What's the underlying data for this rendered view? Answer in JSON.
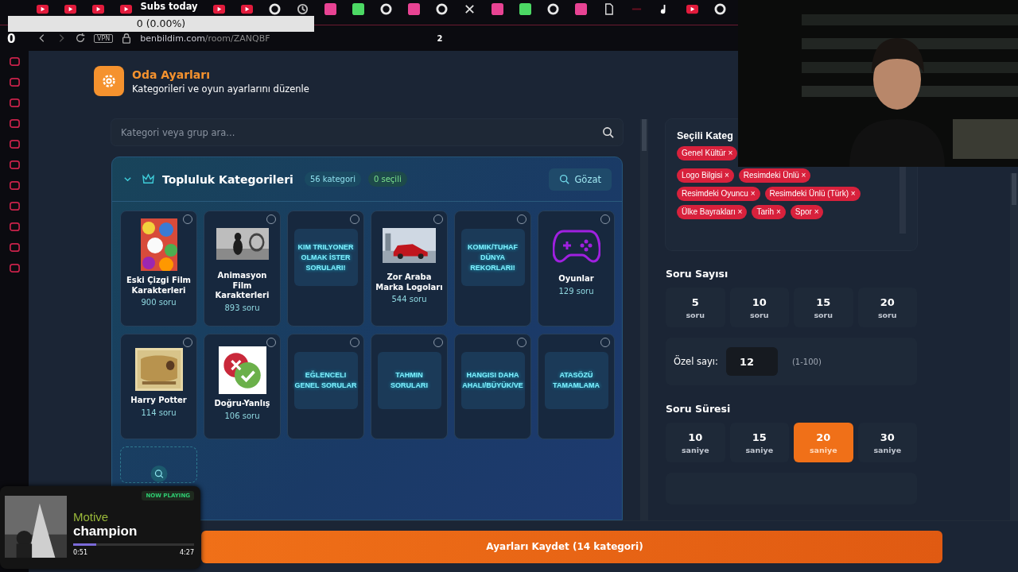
{
  "overlay": {
    "subs_label": "Subs today",
    "subs_value": "0 (0.00%)",
    "counter": "0"
  },
  "browser": {
    "url_host": "benbildim.com",
    "url_path": "/room/ZANQBF",
    "vpn": "VPN",
    "badge": "2"
  },
  "header": {
    "title": "Oda Ayarları",
    "subtitle": "Kategorileri ve oyun ayarlarını düzenle"
  },
  "search": {
    "placeholder": "Kategori veya grup ara..."
  },
  "community": {
    "title": "Topluluk Kategorileri",
    "count": "56 kategori",
    "selected_count": "0 seçili",
    "browse": "Gözat",
    "expanded": true,
    "cards": [
      {
        "kind": "picture",
        "name": "Eski Çizgi Film Karakterleri",
        "count": "900 soru",
        "selected": false
      },
      {
        "kind": "picture",
        "name": "Animasyon Film Karakterleri",
        "count": "893 soru",
        "selected": false
      },
      {
        "kind": "banner",
        "banner": "KIM TRILYONER OLMAK İSTER SORULARI!",
        "selected": false
      },
      {
        "kind": "picture",
        "name": "Zor Araba Marka Logoları",
        "count": "544 soru",
        "selected": false
      },
      {
        "kind": "banner",
        "banner": "KOMIK/TUHAF DÜNYA REKORLARI!",
        "selected": false
      },
      {
        "kind": "gamepad",
        "name": "Oyunlar",
        "count": "129 soru",
        "selected": false
      },
      {
        "kind": "picture",
        "name": "Harry Potter",
        "count": "114 soru",
        "selected": false
      },
      {
        "kind": "truefalse",
        "name": "Doğru-Yanlış",
        "count": "106 soru",
        "selected": false
      },
      {
        "kind": "banner",
        "banner": "EĞLENCELI GENEL SORULAR",
        "selected": false
      },
      {
        "kind": "banner",
        "banner": "TAHMIN SORULARI",
        "selected": false
      },
      {
        "kind": "banner",
        "banner": "HANGISI DAHA AHALI/BÜYÜK/VE",
        "selected": false
      },
      {
        "kind": "banner",
        "banner": "ATASÖZÜ TAMAMLAMA",
        "selected": false
      },
      {
        "kind": "search"
      }
    ]
  },
  "selected_categories": {
    "title": "Seçili Kateg",
    "tags": [
      {
        "label": "Genel Kültür",
        "remove": "×"
      },
      {
        "label": "Logo Bilgisi",
        "remove": "×"
      },
      {
        "label": "Resimdeki Ünlü",
        "remove": "×"
      },
      {
        "label": "Resimdeki Oyuncu",
        "remove": "×"
      },
      {
        "label": "Resimdeki Ünlü (Türk)",
        "remove": "×"
      },
      {
        "label": "Ülke Bayrakları",
        "remove": "×"
      },
      {
        "label": "Tarih",
        "remove": "×"
      },
      {
        "label": "Spor",
        "remove": "×"
      }
    ]
  },
  "question_count": {
    "title": "Soru Sayısı",
    "options": [
      {
        "value": "5",
        "unit": "soru",
        "selected": false
      },
      {
        "value": "10",
        "unit": "soru",
        "selected": false
      },
      {
        "value": "15",
        "unit": "soru",
        "selected": false
      },
      {
        "value": "20",
        "unit": "soru",
        "selected": false
      }
    ],
    "custom_label": "Özel sayı:",
    "custom_value": "12",
    "custom_range": "(1-100)"
  },
  "question_time": {
    "title": "Soru Süresi",
    "options": [
      {
        "value": "10",
        "unit": "saniye",
        "selected": false
      },
      {
        "value": "15",
        "unit": "saniye",
        "selected": false
      },
      {
        "value": "20",
        "unit": "saniye",
        "selected": true
      },
      {
        "value": "30",
        "unit": "saniye",
        "selected": false
      }
    ]
  },
  "save_button": "Ayarları Kaydet (14 kategori)",
  "now_playing": {
    "badge": "NOW PLAYING",
    "artist": "Motive",
    "title": "champion",
    "level": 0.19,
    "elapsed": "0:51",
    "duration": "4:27"
  }
}
